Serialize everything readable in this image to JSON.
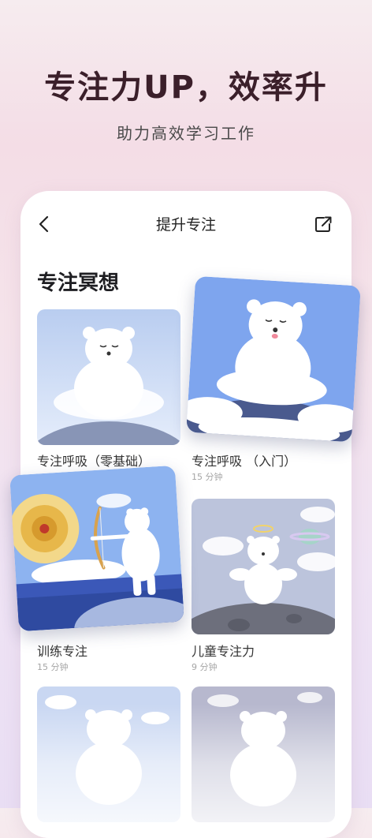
{
  "promo": {
    "headline": "专注力UP，效率升",
    "subline": "助力高效学习工作"
  },
  "navbar": {
    "title": "提升专注",
    "back_icon": "chevron-left-icon",
    "share_icon": "share-icon"
  },
  "section": {
    "title": "专注冥想"
  },
  "cards": [
    {
      "title": "专注呼吸（零基础）",
      "meta": ""
    },
    {
      "title": "专注呼吸 （入门）",
      "meta": "15 分钟"
    },
    {
      "title": "训练专注",
      "meta": "15 分钟"
    },
    {
      "title": "儿童专注力",
      "meta": "9 分钟"
    }
  ],
  "colors": {
    "accent": "#7fa3e8",
    "headline": "#3b1f2a"
  }
}
